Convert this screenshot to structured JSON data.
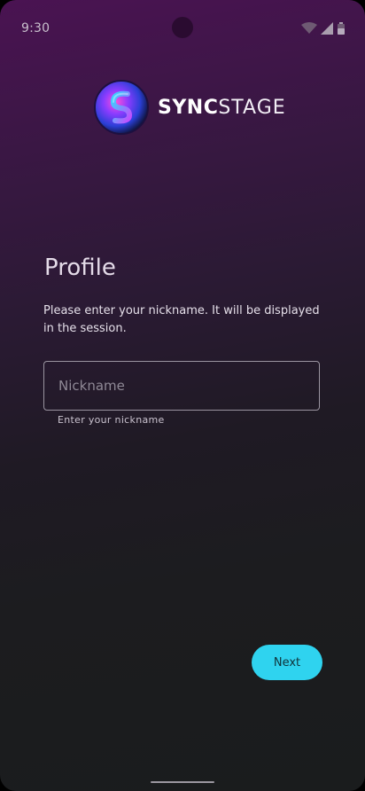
{
  "status_bar": {
    "time": "9:30",
    "icons": [
      "wifi-icon",
      "signal-icon",
      "battery-icon"
    ]
  },
  "logo": {
    "text_bold": "SYNC",
    "text_light": "STAGE",
    "icon": "syncstage-logo-icon"
  },
  "profile": {
    "title": "Profile",
    "description": "Please enter your nickname. It will be displayed in the session.",
    "nickname_placeholder": "Nickname",
    "nickname_value": "",
    "helper_text": "Enter your nickname",
    "next_label": "Next"
  },
  "colors": {
    "accent": "#2fd3ef",
    "background_top": "#4a1352",
    "background_bottom": "#1a1c1d"
  }
}
